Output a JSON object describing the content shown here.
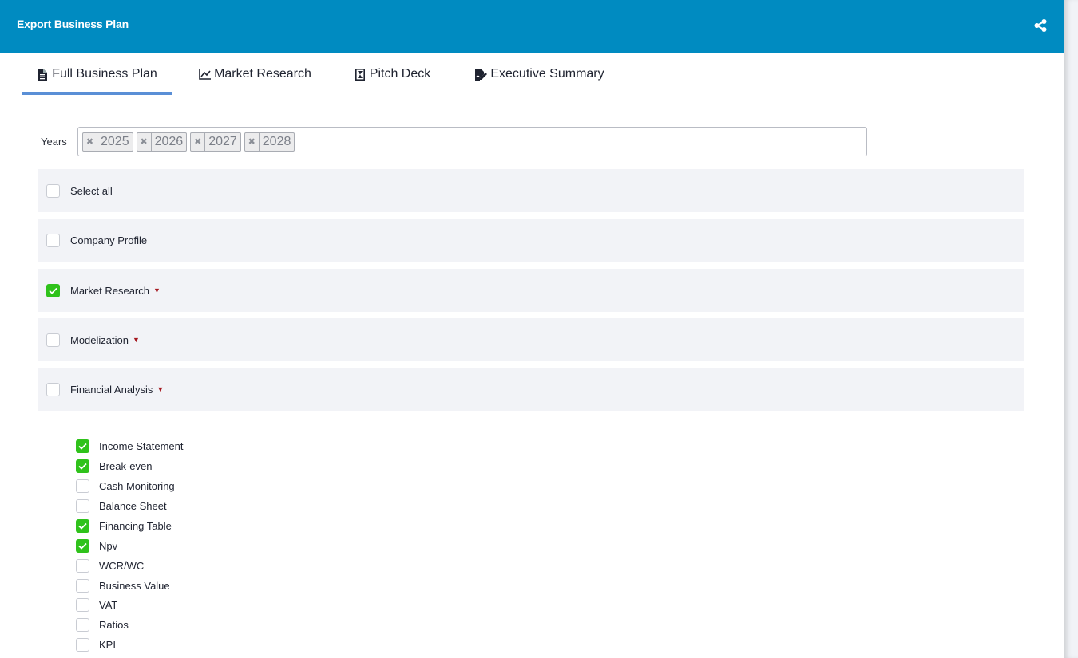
{
  "header": {
    "title": "Export Business Plan",
    "share_icon": "share-icon"
  },
  "tabs": [
    {
      "label": "Full Business Plan",
      "icon": "document-icon",
      "active": true
    },
    {
      "label": "Market Research",
      "icon": "line-chart-icon",
      "active": false
    },
    {
      "label": "Pitch Deck",
      "icon": "hourglass-icon",
      "active": false
    },
    {
      "label": "Executive Summary",
      "icon": "signature-icon",
      "active": false
    }
  ],
  "years": {
    "label": "Years",
    "selected": [
      "2025",
      "2026",
      "2027",
      "2028"
    ]
  },
  "sections": [
    {
      "label": "Select all",
      "checked": false,
      "expandable": false
    },
    {
      "label": "Company Profile",
      "checked": false,
      "expandable": false
    },
    {
      "label": "Market Research",
      "checked": true,
      "expandable": true
    },
    {
      "label": "Modelization",
      "checked": false,
      "expandable": true
    },
    {
      "label": "Financial Analysis",
      "checked": false,
      "expandable": true
    }
  ],
  "financial_items": [
    {
      "label": "Income Statement",
      "checked": true
    },
    {
      "label": "Break-even",
      "checked": true
    },
    {
      "label": "Cash Monitoring",
      "checked": false
    },
    {
      "label": "Balance Sheet",
      "checked": false
    },
    {
      "label": "Financing Table",
      "checked": true
    },
    {
      "label": "Npv",
      "checked": true
    },
    {
      "label": "WCR/WC",
      "checked": false
    },
    {
      "label": "Business Value",
      "checked": false
    },
    {
      "label": "VAT",
      "checked": false
    },
    {
      "label": "Ratios",
      "checked": false
    },
    {
      "label": "KPI",
      "checked": false
    }
  ],
  "colors": {
    "header_bg": "#008bc1",
    "check_green": "#2fc21b",
    "tab_underline": "#5a8fd6",
    "caret_red": "#a5181f"
  }
}
